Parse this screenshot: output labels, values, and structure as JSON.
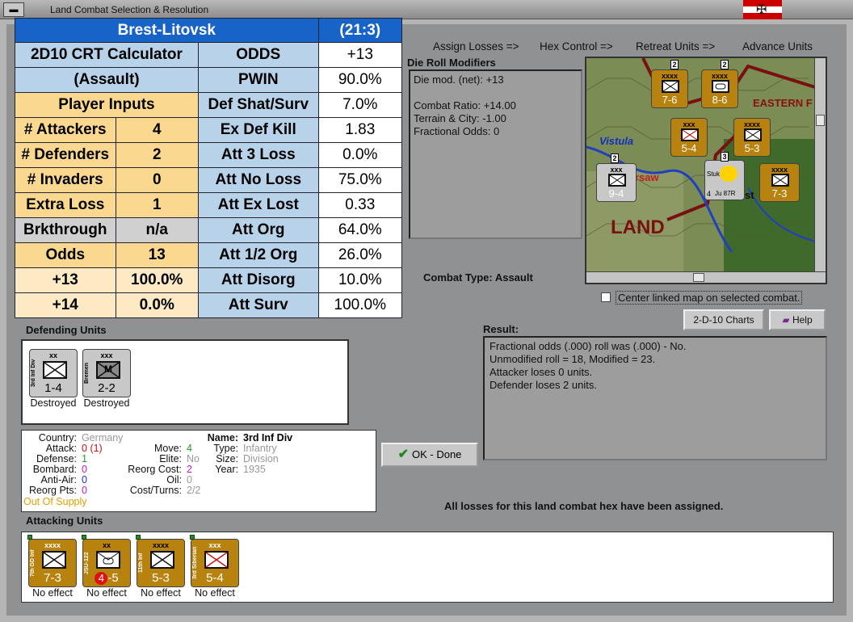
{
  "window": {
    "title": "Land Combat Selection & Resolution"
  },
  "phases": [
    "Assign Losses =>",
    "Hex Control =>",
    "Retreat Units =>",
    "Advance Units"
  ],
  "crt": {
    "hex_name": "Brest-Litovsk",
    "hex_code": "(21:3)",
    "calc_title": "2D10 CRT Calculator",
    "calc_subtitle": "(Assault)",
    "player_inputs": "Player Inputs",
    "inputs": [
      {
        "label": "# Attackers",
        "value": "4"
      },
      {
        "label": "# Defenders",
        "value": "2"
      },
      {
        "label": "# Invaders",
        "value": "0"
      },
      {
        "label": "Extra Loss",
        "value": "1"
      },
      {
        "label": "Brkthrough",
        "value": "n/a"
      },
      {
        "label": "Odds",
        "value": "13"
      }
    ],
    "odds_rows": [
      {
        "label": "+13",
        "value": "100.0%"
      },
      {
        "label": "+14",
        "value": "0.0%"
      }
    ],
    "results": [
      {
        "label": "ODDS",
        "value": "+13"
      },
      {
        "label": "PWIN",
        "value": "90.0%"
      },
      {
        "label": "Def Shat/Surv",
        "value": "7.0%"
      },
      {
        "label": "Ex Def Kill",
        "value": "1.83"
      },
      {
        "label": "Att 3 Loss",
        "value": "0.0%"
      },
      {
        "label": "Att No Loss",
        "value": "75.0%"
      },
      {
        "label": "Att Ex Lost",
        "value": "0.33"
      },
      {
        "label": "Att Org",
        "value": "64.0%"
      },
      {
        "label": "Att 1/2 Org",
        "value": "26.0%"
      },
      {
        "label": "Att Disorg",
        "value": "10.0%"
      },
      {
        "label": "Att Surv",
        "value": "100.0%"
      }
    ]
  },
  "die_roll": {
    "title": "Die Roll Modifiers",
    "lines": [
      "Die mod. (net): +13",
      "",
      "Combat Ratio: +14.00",
      "Terrain & City: -1.00",
      "Fractional Odds: 0"
    ]
  },
  "combat_type": "Combat Type:  Assault",
  "map": {
    "labels": [
      "EASTERN F",
      "Vistula",
      "rsaw",
      "LAND",
      "st"
    ],
    "units": [
      {
        "size": "xxxx",
        "str": "7-6",
        "side": "7th Army"
      },
      {
        "size": "xxxx",
        "str": "8-6",
        "side": "1st Arm"
      },
      {
        "size": "xxx",
        "str": "5-4",
        "side": "3rd Siberian"
      },
      {
        "size": "xxxx",
        "str": "5-3",
        "side": "11th Inf"
      },
      {
        "size": "xxx",
        "str": "9-4",
        "side": ""
      },
      {
        "size": "xxxx",
        "str": "7-3",
        "side": "7th GD Inf"
      }
    ],
    "stack_counts": [
      "2",
      "2",
      "2",
      "3"
    ],
    "air_unit": "Ju 87R",
    "air_label": "Stuka",
    "air_value": "4"
  },
  "center_linked": "Center linked map on selected combat.",
  "buttons": {
    "charts": "2-D-10 Charts",
    "help": "Help",
    "ok": "OK - Done"
  },
  "defending": {
    "title": "Defending Units",
    "units": [
      {
        "size": "xx",
        "side": "3rd Inf Div",
        "str": "1-4",
        "status": "Destroyed"
      },
      {
        "size": "xxx",
        "side": "Bremen",
        "str": "2-2",
        "status": "Destroyed",
        "mark": "M"
      }
    ]
  },
  "info": {
    "country_l": "Country:",
    "country": "Germany",
    "attack_l": "Attack:",
    "attack": "0",
    "attack_paren": "(1)",
    "defense_l": "Defense:",
    "defense": "1",
    "bombard_l": "Bombard:",
    "bombard": "0",
    "aa_l": "Anti-Air:",
    "aa": "0",
    "reorg_l": "Reorg Pts:",
    "reorg": "0",
    "supply": "Out Of Supply",
    "move_l": "Move:",
    "move": "4",
    "elite_l": "Elite:",
    "elite": "No",
    "rcost_l": "Reorg Cost:",
    "rcost": "2",
    "oil_l": "Oil:",
    "oil": "0",
    "ct_l": "Cost/Turns:",
    "ct": "2/2",
    "name_l": "Name:",
    "name": "3rd Inf Div",
    "type_l": "Type:",
    "type": "Infantry",
    "size_l": "Size:",
    "size": "Division",
    "year_l": "Year:",
    "year": "1935"
  },
  "result": {
    "title": "Result:",
    "lines": [
      "Fractional odds (.000) roll was (.000)  -  No.",
      "Unmodified roll = 18, Modified = 23.",
      "Attacker loses 0 units.",
      "Defender loses 2 units."
    ]
  },
  "all_losses": "All losses for this land combat hex have been assigned.",
  "attacking": {
    "title": "Attacking Units",
    "units": [
      {
        "size": "xxxx",
        "side": "7th GD Inf",
        "str": "7-3",
        "status": "No effect"
      },
      {
        "size": "xx",
        "side": "JSU-122",
        "str_a": "4",
        "str_b": "-5",
        "status": "No effect"
      },
      {
        "size": "xxxx",
        "side": "11th Inf",
        "str": "5-3",
        "status": "No effect"
      },
      {
        "size": "xxx",
        "side": "3rd Siberian",
        "str": "5-4",
        "status": "No effect"
      }
    ]
  },
  "colors": {
    "crt_header": "#1763c8",
    "crt_blue": "#b8d2ea",
    "crt_gold": "#fbd88f",
    "soviet_unit": "#b8820f",
    "german_unit": "#c8c8c8"
  }
}
